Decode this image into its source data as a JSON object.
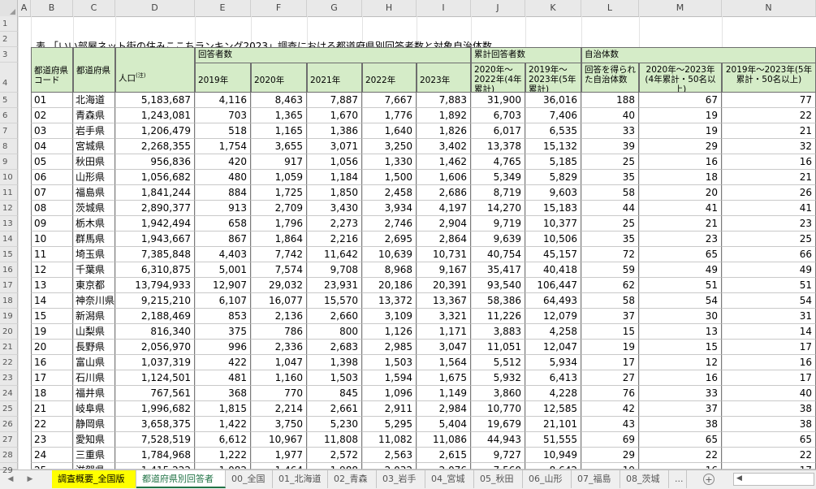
{
  "columns": [
    "A",
    "B",
    "C",
    "D",
    "E",
    "F",
    "G",
    "H",
    "I",
    "J",
    "K",
    "L",
    "M",
    "N"
  ],
  "row_numbers": [
    "1",
    "2",
    "3",
    "4",
    "5",
    "6",
    "7",
    "8",
    "9",
    "10",
    "11",
    "12",
    "13",
    "14",
    "15",
    "16",
    "17",
    "18",
    "19",
    "20",
    "21",
    "22",
    "23",
    "24",
    "25",
    "26",
    "27",
    "28",
    "29"
  ],
  "title": "表.「いい部屋ネット街の住みここちランキング2023」調査における都道府県別回答者数と対象自治体数",
  "group_headers": {
    "respondents": "回答者数",
    "cumulative": "累計回答者数",
    "municipalities": "自治体数"
  },
  "headers": {
    "code": "都道府県コード",
    "pref": "都道府県",
    "population": "人口",
    "population_note": "(注)",
    "y2019": "2019年",
    "y2020": "2020年",
    "y2021": "2021年",
    "y2022": "2022年",
    "y2023": "2023年",
    "cum_2020_2022": "2020年～2022年(4年累計)",
    "cum_2019_2023": "2019年～2023年(5年累計)",
    "muni_answered": "回答を得られた自治体数",
    "muni_4yr_50": "2020年～2023年(4年累計・50名以上)",
    "muni_5yr_50": "2019年～2023年(5年累計・50名以上)"
  },
  "rows": [
    [
      "01",
      "北海道",
      "5,183,687",
      "4,116",
      "8,463",
      "7,887",
      "7,667",
      "7,883",
      "31,900",
      "36,016",
      "188",
      "67",
      "77"
    ],
    [
      "02",
      "青森県",
      "1,243,081",
      "703",
      "1,365",
      "1,670",
      "1,776",
      "1,892",
      "6,703",
      "7,406",
      "40",
      "19",
      "22"
    ],
    [
      "03",
      "岩手県",
      "1,206,479",
      "518",
      "1,165",
      "1,386",
      "1,640",
      "1,826",
      "6,017",
      "6,535",
      "33",
      "19",
      "21"
    ],
    [
      "04",
      "宮城県",
      "2,268,355",
      "1,754",
      "3,655",
      "3,071",
      "3,250",
      "3,402",
      "13,378",
      "15,132",
      "39",
      "29",
      "32"
    ],
    [
      "05",
      "秋田県",
      "956,836",
      "420",
      "917",
      "1,056",
      "1,330",
      "1,462",
      "4,765",
      "5,185",
      "25",
      "16",
      "16"
    ],
    [
      "06",
      "山形県",
      "1,056,682",
      "480",
      "1,059",
      "1,184",
      "1,500",
      "1,606",
      "5,349",
      "5,829",
      "35",
      "18",
      "21"
    ],
    [
      "07",
      "福島県",
      "1,841,244",
      "884",
      "1,725",
      "1,850",
      "2,458",
      "2,686",
      "8,719",
      "9,603",
      "58",
      "20",
      "26"
    ],
    [
      "08",
      "茨城県",
      "2,890,377",
      "913",
      "2,709",
      "3,430",
      "3,934",
      "4,197",
      "14,270",
      "15,183",
      "44",
      "41",
      "41"
    ],
    [
      "09",
      "栃木県",
      "1,942,494",
      "658",
      "1,796",
      "2,273",
      "2,746",
      "2,904",
      "9,719",
      "10,377",
      "25",
      "21",
      "23"
    ],
    [
      "10",
      "群馬県",
      "1,943,667",
      "867",
      "1,864",
      "2,216",
      "2,695",
      "2,864",
      "9,639",
      "10,506",
      "35",
      "23",
      "25"
    ],
    [
      "11",
      "埼玉県",
      "7,385,848",
      "4,403",
      "7,742",
      "11,642",
      "10,639",
      "10,731",
      "40,754",
      "45,157",
      "72",
      "65",
      "66"
    ],
    [
      "12",
      "千葉県",
      "6,310,875",
      "5,001",
      "7,574",
      "9,708",
      "8,968",
      "9,167",
      "35,417",
      "40,418",
      "59",
      "49",
      "49"
    ],
    [
      "13",
      "東京都",
      "13,794,933",
      "12,907",
      "29,032",
      "23,931",
      "20,186",
      "20,391",
      "93,540",
      "106,447",
      "62",
      "51",
      "51"
    ],
    [
      "14",
      "神奈川県",
      "9,215,210",
      "6,107",
      "16,077",
      "15,570",
      "13,372",
      "13,367",
      "58,386",
      "64,493",
      "58",
      "54",
      "54"
    ],
    [
      "15",
      "新潟県",
      "2,188,469",
      "853",
      "2,136",
      "2,660",
      "3,109",
      "3,321",
      "11,226",
      "12,079",
      "37",
      "30",
      "31"
    ],
    [
      "19",
      "山梨県",
      "816,340",
      "375",
      "786",
      "800",
      "1,126",
      "1,171",
      "3,883",
      "4,258",
      "15",
      "13",
      "14"
    ],
    [
      "20",
      "長野県",
      "2,056,970",
      "996",
      "2,336",
      "2,683",
      "2,985",
      "3,047",
      "11,051",
      "12,047",
      "19",
      "15",
      "17"
    ],
    [
      "16",
      "富山県",
      "1,037,319",
      "422",
      "1,047",
      "1,398",
      "1,503",
      "1,564",
      "5,512",
      "5,934",
      "17",
      "12",
      "16"
    ],
    [
      "17",
      "石川県",
      "1,124,501",
      "481",
      "1,160",
      "1,503",
      "1,594",
      "1,675",
      "5,932",
      "6,413",
      "27",
      "16",
      "17"
    ],
    [
      "18",
      "福井県",
      "767,561",
      "368",
      "770",
      "845",
      "1,096",
      "1,149",
      "3,860",
      "4,228",
      "76",
      "33",
      "40"
    ],
    [
      "21",
      "岐阜県",
      "1,996,682",
      "1,815",
      "2,214",
      "2,661",
      "2,911",
      "2,984",
      "10,770",
      "12,585",
      "42",
      "37",
      "38"
    ],
    [
      "22",
      "静岡県",
      "3,658,375",
      "1,422",
      "3,750",
      "5,230",
      "5,295",
      "5,404",
      "19,679",
      "21,101",
      "43",
      "38",
      "38"
    ],
    [
      "23",
      "愛知県",
      "7,528,519",
      "6,612",
      "10,967",
      "11,808",
      "11,082",
      "11,086",
      "44,943",
      "51,555",
      "69",
      "65",
      "65"
    ],
    [
      "24",
      "三重県",
      "1,784,968",
      "1,222",
      "1,977",
      "2,572",
      "2,563",
      "2,615",
      "9,727",
      "10,949",
      "29",
      "22",
      "22"
    ],
    [
      "25",
      "滋賀県",
      "1,415,222",
      "1,082",
      "1,464",
      "1,988",
      "2,032",
      "2,076",
      "7,560",
      "8,642",
      "19",
      "16",
      "17"
    ]
  ],
  "tabs": [
    "調査概要_全国版",
    "都道府県別回答者",
    "00_全国",
    "01_北海道",
    "02_青森",
    "03_岩手",
    "04_宮城",
    "05_秋田",
    "06_山形",
    "07_福島",
    "08_茨城",
    "..."
  ],
  "active_tab_index": 1,
  "colors": {
    "header_green": "#d5ecc8",
    "tab_yellow": "#ffff00",
    "active_tab_text": "#217346"
  }
}
